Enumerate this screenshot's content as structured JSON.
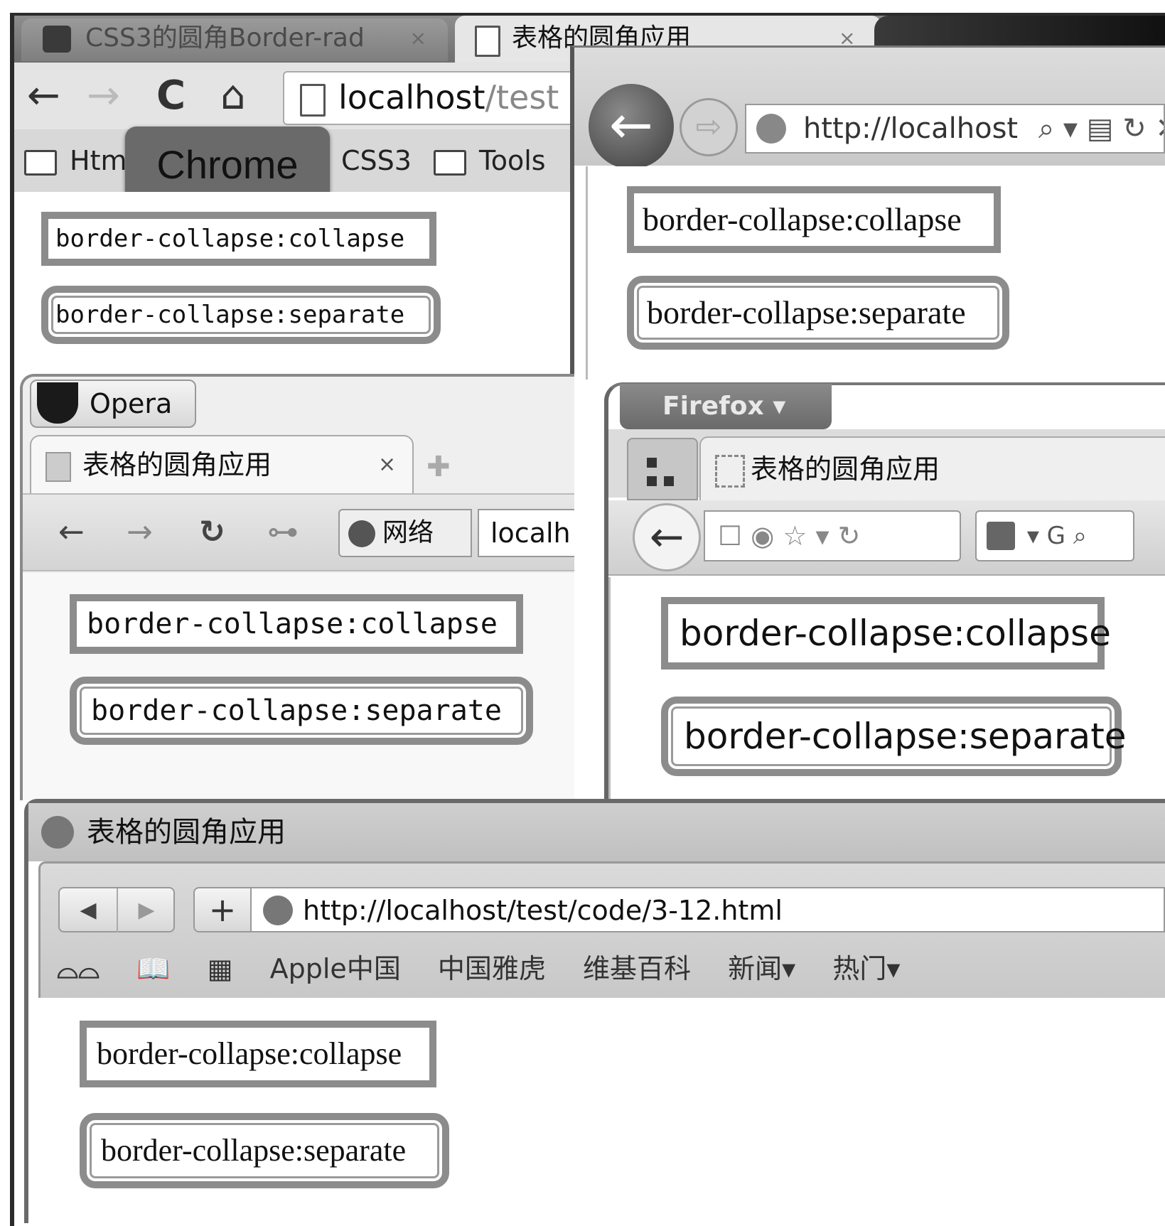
{
  "demo": {
    "collapse_label": "border-collapse:collapse",
    "separate_label": "border-collapse:separate"
  },
  "chrome": {
    "badge": "Chrome",
    "tab_inactive_title": "CSS3的圆角Border-rad",
    "tab_active_title": "表格的圆角应用",
    "tab_close": "×",
    "nav": {
      "back": "←",
      "forward": "→",
      "reload": "C",
      "home": "⌂"
    },
    "omnibox": {
      "host": "localhost",
      "path": "/test"
    },
    "bookmarks": [
      "Html",
      "CSS3",
      "Tools"
    ]
  },
  "ie": {
    "address": "http://localhost",
    "address_icons": "⌕ ▾ ▤ ↻ ✕",
    "nav": {
      "back": "←",
      "forward": "⇨"
    }
  },
  "opera": {
    "menu": "Opera",
    "tab_title": "表格的圆角应用",
    "tab_close": "×",
    "new_tab": "✚",
    "nav": {
      "back": "←",
      "forward": "→",
      "reload": "↻",
      "key": "⊶"
    },
    "net_label": "网络",
    "url": "localh"
  },
  "firefox": {
    "menu": "Firefox ▾",
    "tab_title": "表格的圆角应用",
    "nav": {
      "back": "←"
    },
    "url_icons": "☐   ◉ ☆ ▾ ↻",
    "search_icons": "▾ G ⌕"
  },
  "safari": {
    "window_title": "表格的圆角应用",
    "nav": {
      "back": "◀",
      "forward": "▶"
    },
    "add": "+",
    "address": "http://localhost/test/code/3-12.html",
    "bookmarks": [
      "Apple中国",
      "中国雅虎",
      "维基百科",
      "新闻▾",
      "热门▾"
    ],
    "bookmark_icons": {
      "reader": "⌓⌓",
      "book": "📖",
      "grid": "▦"
    }
  }
}
